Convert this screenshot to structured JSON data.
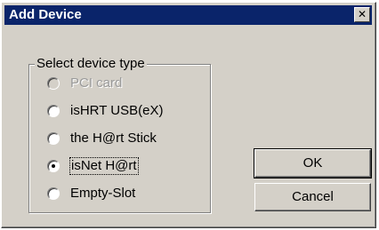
{
  "window": {
    "title": "Add Device",
    "close_label": "✕"
  },
  "group": {
    "label": "Select device type",
    "options": [
      {
        "label": "PCI card",
        "enabled": false,
        "selected": false
      },
      {
        "label": "isHRT USB(eX)",
        "enabled": true,
        "selected": false
      },
      {
        "label": "the H@rt Stick",
        "enabled": true,
        "selected": false
      },
      {
        "label": "isNet H@rt",
        "enabled": true,
        "selected": true
      },
      {
        "label": "Empty-Slot",
        "enabled": true,
        "selected": false
      }
    ]
  },
  "buttons": {
    "ok_label": "OK",
    "cancel_label": "Cancel"
  },
  "colors": {
    "titlebar": "#0a246a",
    "face": "#d4d0c8"
  }
}
